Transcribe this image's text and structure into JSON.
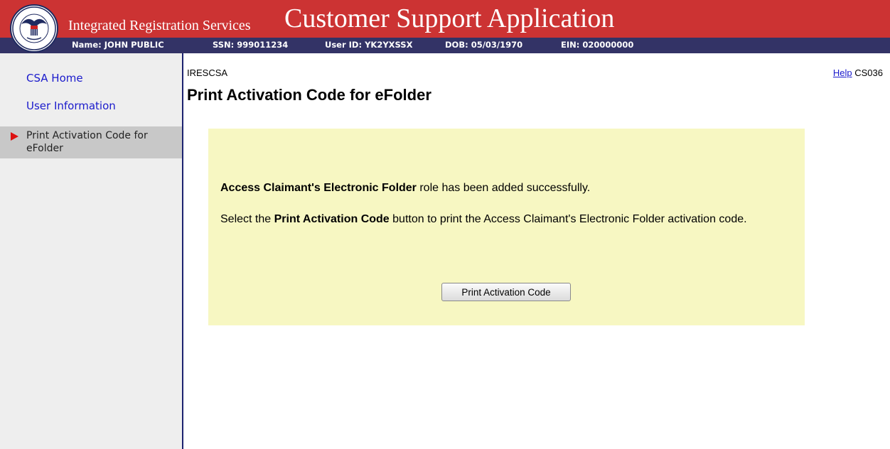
{
  "header": {
    "agency_name": "Integrated Registration Services",
    "app_title": "Customer Support Application",
    "seal_text": "SOCIAL SECURITY ADMINISTRATION USA",
    "info": {
      "name": "Name: JOHN PUBLIC",
      "ssn": "SSN: 999011234",
      "user_id": "User ID: YK2YXSSX",
      "dob": "DOB: 05/03/1970",
      "ein": "EIN: 020000000"
    },
    "colors": {
      "top_bar": "#cc3333",
      "info_bar": "#333366"
    }
  },
  "sidebar": {
    "items": [
      {
        "label": "CSA Home",
        "active": false
      },
      {
        "label": "User Information",
        "active": false
      },
      {
        "label": "Print Activation Code for eFolder",
        "active": true
      }
    ],
    "active_icon": "red-arrow-icon"
  },
  "main": {
    "breadcrumb": "IRESCSA",
    "help_label": "Help",
    "screen_code": "CS036",
    "title": "Print Activation Code for eFolder",
    "message": {
      "line1_bold": "Access Claimant's Electronic Folder",
      "line1_rest": " role has been added successfully.",
      "line2_pre": "Select the ",
      "line2_bold": "Print Activation Code",
      "line2_rest": " button to print the Access Claimant's Electronic Folder activation code."
    },
    "button_label": "Print Activation Code",
    "panel_color": "#f7f7c2"
  }
}
